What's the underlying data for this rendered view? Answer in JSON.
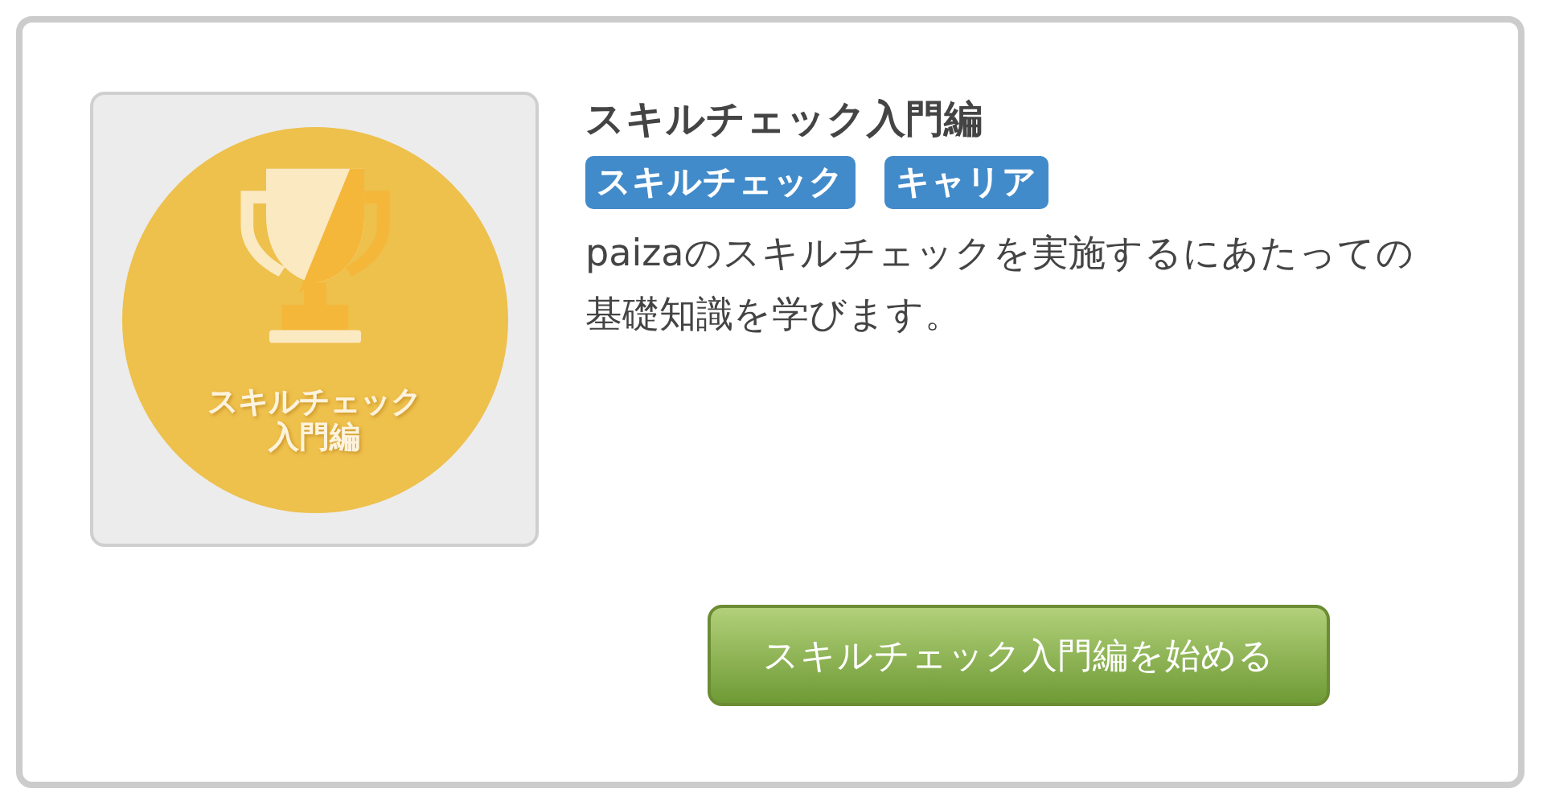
{
  "course": {
    "title": "スキルチェック入門編",
    "badge": {
      "lines": [
        "スキルチェック",
        "入門編"
      ]
    },
    "tags": [
      "スキルチェック",
      "キャリア"
    ],
    "description": "paizaのスキルチェックを実施するにあたっての基礎知識を学びます。",
    "start_button": "スキルチェック入門編を始める"
  }
}
